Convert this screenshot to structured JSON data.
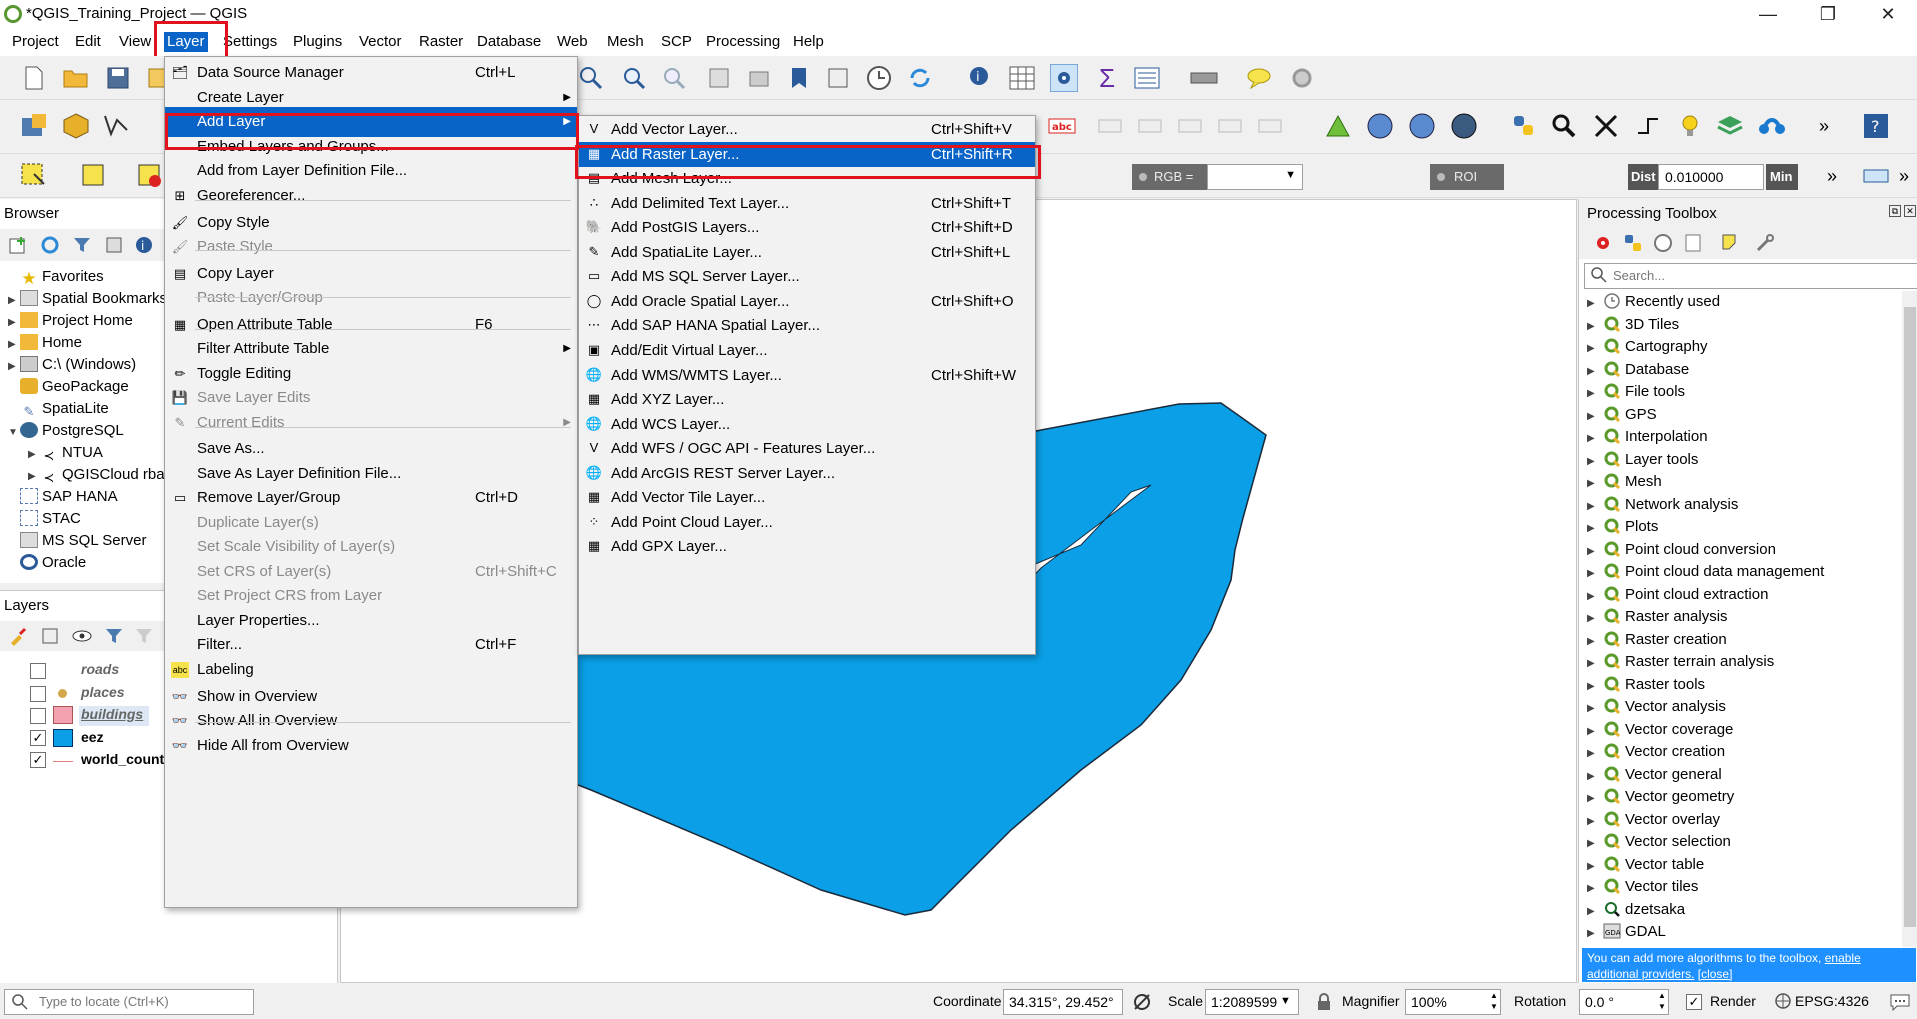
{
  "window": {
    "title": "*QGIS_Training_Project — QGIS",
    "minimize": "—",
    "maximize": "❐",
    "close": "✕"
  },
  "menubar": [
    "Project",
    "Edit",
    "View",
    "Layer",
    "Settings",
    "Plugins",
    "Vector",
    "Raster",
    "Database",
    "Web",
    "Mesh",
    "SCP",
    "Processing",
    "Help"
  ],
  "toolbar3": {
    "rgb_label": "RGB =",
    "roi_label": "ROI",
    "dist_label": "Dist",
    "dist_value": "0.010000",
    "min_label": "Min"
  },
  "browser": {
    "title": "Browser",
    "items": [
      "Favorites",
      "Spatial Bookmarks",
      "Project Home",
      "Home",
      "C:\\ (Windows)",
      "GeoPackage",
      "SpatiaLite",
      "PostgreSQL",
      "NTUA",
      "QGISCloud rba",
      "SAP HANA",
      "STAC",
      "MS SQL Server",
      "Oracle"
    ]
  },
  "layers": {
    "title": "Layers",
    "items": [
      {
        "name": "roads",
        "checked": false
      },
      {
        "name": "places",
        "checked": false
      },
      {
        "name": "buildings",
        "checked": false
      },
      {
        "name": "eez",
        "checked": true
      },
      {
        "name": "world_countries",
        "checked": true
      }
    ]
  },
  "layer_menu": {
    "items": [
      {
        "label": "Data Source Manager",
        "shortcut": "Ctrl+L"
      },
      {
        "label": "Create Layer",
        "shortcut": ""
      },
      {
        "label": "Add Layer",
        "shortcut": ""
      },
      {
        "label": "Embed Layers and Groups...",
        "shortcut": ""
      },
      {
        "label": "Add from Layer Definition File...",
        "shortcut": ""
      },
      {
        "label": "Georeferencer...",
        "shortcut": ""
      },
      {
        "label": "Copy Style",
        "shortcut": ""
      },
      {
        "label": "Paste Style",
        "shortcut": ""
      },
      {
        "label": "Copy Layer",
        "shortcut": ""
      },
      {
        "label": "Paste Layer/Group",
        "shortcut": ""
      },
      {
        "label": "Open Attribute Table",
        "shortcut": "F6"
      },
      {
        "label": "Filter Attribute Table",
        "shortcut": ""
      },
      {
        "label": "Toggle Editing",
        "shortcut": ""
      },
      {
        "label": "Save Layer Edits",
        "shortcut": ""
      },
      {
        "label": "Current Edits",
        "shortcut": ""
      },
      {
        "label": "Save As...",
        "shortcut": ""
      },
      {
        "label": "Save As Layer Definition File...",
        "shortcut": ""
      },
      {
        "label": "Remove Layer/Group",
        "shortcut": "Ctrl+D"
      },
      {
        "label": "Duplicate Layer(s)",
        "shortcut": ""
      },
      {
        "label": "Set Scale Visibility of Layer(s)",
        "shortcut": ""
      },
      {
        "label": "Set CRS of Layer(s)",
        "shortcut": "Ctrl+Shift+C"
      },
      {
        "label": "Set Project CRS from Layer",
        "shortcut": ""
      },
      {
        "label": "Layer Properties...",
        "shortcut": ""
      },
      {
        "label": "Filter...",
        "shortcut": "Ctrl+F"
      },
      {
        "label": "Labeling",
        "shortcut": ""
      },
      {
        "label": "Show in Overview",
        "shortcut": ""
      },
      {
        "label": "Show All in Overview",
        "shortcut": ""
      },
      {
        "label": "Hide All from Overview",
        "shortcut": ""
      }
    ]
  },
  "add_layer_menu": {
    "items": [
      {
        "label": "Add Vector Layer...",
        "shortcut": "Ctrl+Shift+V"
      },
      {
        "label": "Add Raster Layer...",
        "shortcut": "Ctrl+Shift+R"
      },
      {
        "label": "Add Mesh Layer...",
        "shortcut": ""
      },
      {
        "label": "Add Delimited Text Layer...",
        "shortcut": "Ctrl+Shift+T"
      },
      {
        "label": "Add PostGIS Layers...",
        "shortcut": "Ctrl+Shift+D"
      },
      {
        "label": "Add SpatiaLite Layer...",
        "shortcut": "Ctrl+Shift+L"
      },
      {
        "label": "Add MS SQL Server Layer...",
        "shortcut": ""
      },
      {
        "label": "Add Oracle Spatial Layer...",
        "shortcut": "Ctrl+Shift+O"
      },
      {
        "label": "Add SAP HANA Spatial Layer...",
        "shortcut": ""
      },
      {
        "label": "Add/Edit Virtual Layer...",
        "shortcut": ""
      },
      {
        "label": "Add WMS/WMTS Layer...",
        "shortcut": "Ctrl+Shift+W"
      },
      {
        "label": "Add XYZ Layer...",
        "shortcut": ""
      },
      {
        "label": "Add WCS Layer...",
        "shortcut": ""
      },
      {
        "label": "Add WFS / OGC API - Features Layer...",
        "shortcut": ""
      },
      {
        "label": "Add ArcGIS REST Server Layer...",
        "shortcut": ""
      },
      {
        "label": "Add Vector Tile Layer...",
        "shortcut": ""
      },
      {
        "label": "Add Point Cloud Layer...",
        "shortcut": ""
      },
      {
        "label": "Add GPX Layer...",
        "shortcut": ""
      }
    ]
  },
  "processing": {
    "title": "Processing Toolbox",
    "search_placeholder": "Search...",
    "items": [
      "Recently used",
      "3D Tiles",
      "Cartography",
      "Database",
      "File tools",
      "GPS",
      "Interpolation",
      "Layer tools",
      "Mesh",
      "Network analysis",
      "Plots",
      "Point cloud conversion",
      "Point cloud data management",
      "Point cloud extraction",
      "Raster analysis",
      "Raster creation",
      "Raster terrain analysis",
      "Raster tools",
      "Vector analysis",
      "Vector coverage",
      "Vector creation",
      "Vector general",
      "Vector geometry",
      "Vector overlay",
      "Vector selection",
      "Vector table",
      "Vector tiles",
      "dzetsaka",
      "GDAL"
    ],
    "notice": "You can add more algorithms to the toolbox,",
    "notice_link": "enable additional providers.",
    "notice_close": "[close]"
  },
  "status": {
    "locate_placeholder": "Type to locate (Ctrl+K)",
    "coordinate_label": "Coordinate",
    "coordinate_value": "34.315°, 29.452°",
    "scale_label": "Scale",
    "scale_value": "1:2089599",
    "magnifier_label": "Magnifier",
    "magnifier_value": "100%",
    "rotation_label": "Rotation",
    "rotation_value": "0.0 °",
    "render_label": "Render",
    "crs": "EPSG:4326"
  },
  "colors": {
    "highlight": "#0a64c8",
    "eez_fill": "#0a9fe6",
    "annotation_red": "#e0121d"
  }
}
